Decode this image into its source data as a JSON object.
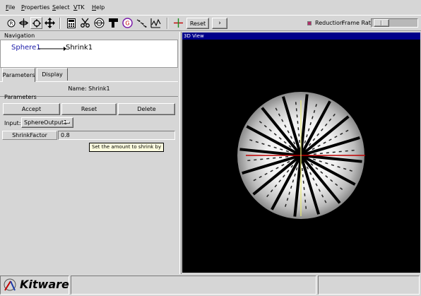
{
  "menu": {
    "items": [
      "File",
      "Properties",
      "Select",
      "VTK",
      "Help"
    ]
  },
  "toolbar": {
    "reset_label": "Reset",
    "next_label": "›",
    "reduction_label": "Reduction",
    "frame_rate_label": "Frame Rate",
    "reduction_checked": true,
    "frame_rate_level": 0.08,
    "icons": [
      "reset-camera-icon",
      "rotate-icon",
      "rotate-3d-icon",
      "translate-icon",
      "calculator-icon",
      "cut-icon",
      "contour-icon",
      "threshold-icon",
      "clip-icon",
      "glyph-icon",
      "probe-icon",
      "axes-icon"
    ]
  },
  "navigation": {
    "group_label": "Navigation",
    "source_node": "Sphere1",
    "target_node": "Shrink1"
  },
  "tabs": {
    "parameters": "Parameters",
    "display": "Display"
  },
  "parameters": {
    "name_text": "Name: Shrink1",
    "group_label": "Parameters",
    "accept_label": "Accept",
    "reset_label": "Reset",
    "delete_label": "Delete",
    "input_label": "Input:",
    "input_value": "SphereOutput1",
    "shrink_factor_label": "ShrinkFactor",
    "shrink_factor_value": "0.8",
    "tooltip": "Set the amount to shrink by"
  },
  "view": {
    "title": "3D View",
    "background_color": "#000000",
    "x_axis_color": "#c00000",
    "y_axis_color": "#e8e870"
  },
  "status": {
    "logo_text": "Kitware"
  },
  "colors": {
    "window_bg": "#d6d6d6",
    "title_bar": "#00008a",
    "node_link": "#1a1aa8"
  }
}
